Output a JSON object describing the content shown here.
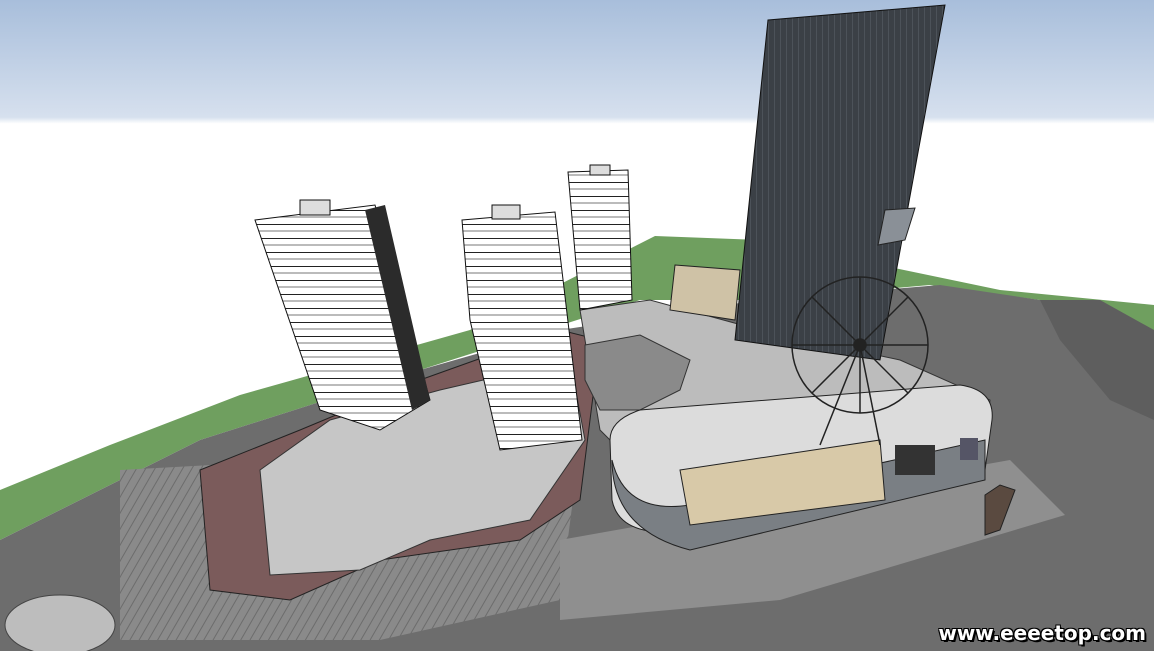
{
  "scene": {
    "description_kind": "3D architectural massing model render",
    "colors": {
      "sky_top": "#a9bfdc",
      "sky_bottom": "#ffffff",
      "grass": "#6a9b5b",
      "road": "#6f6f6f",
      "plaza": "#c9c9c9",
      "podium_roof": "#bdbdbd",
      "brick_roof": "#7c5c5c",
      "tower_glass": "#3a3f45",
      "mall_facade": "#d8c9a8"
    },
    "elements": [
      "residential-tower",
      "residential-tower",
      "residential-tower",
      "office-tower",
      "shopping-mall",
      "ferris-wheel",
      "podium",
      "plaza",
      "roads",
      "lawn"
    ]
  },
  "watermark": {
    "text": "www.eeeetop.com"
  }
}
